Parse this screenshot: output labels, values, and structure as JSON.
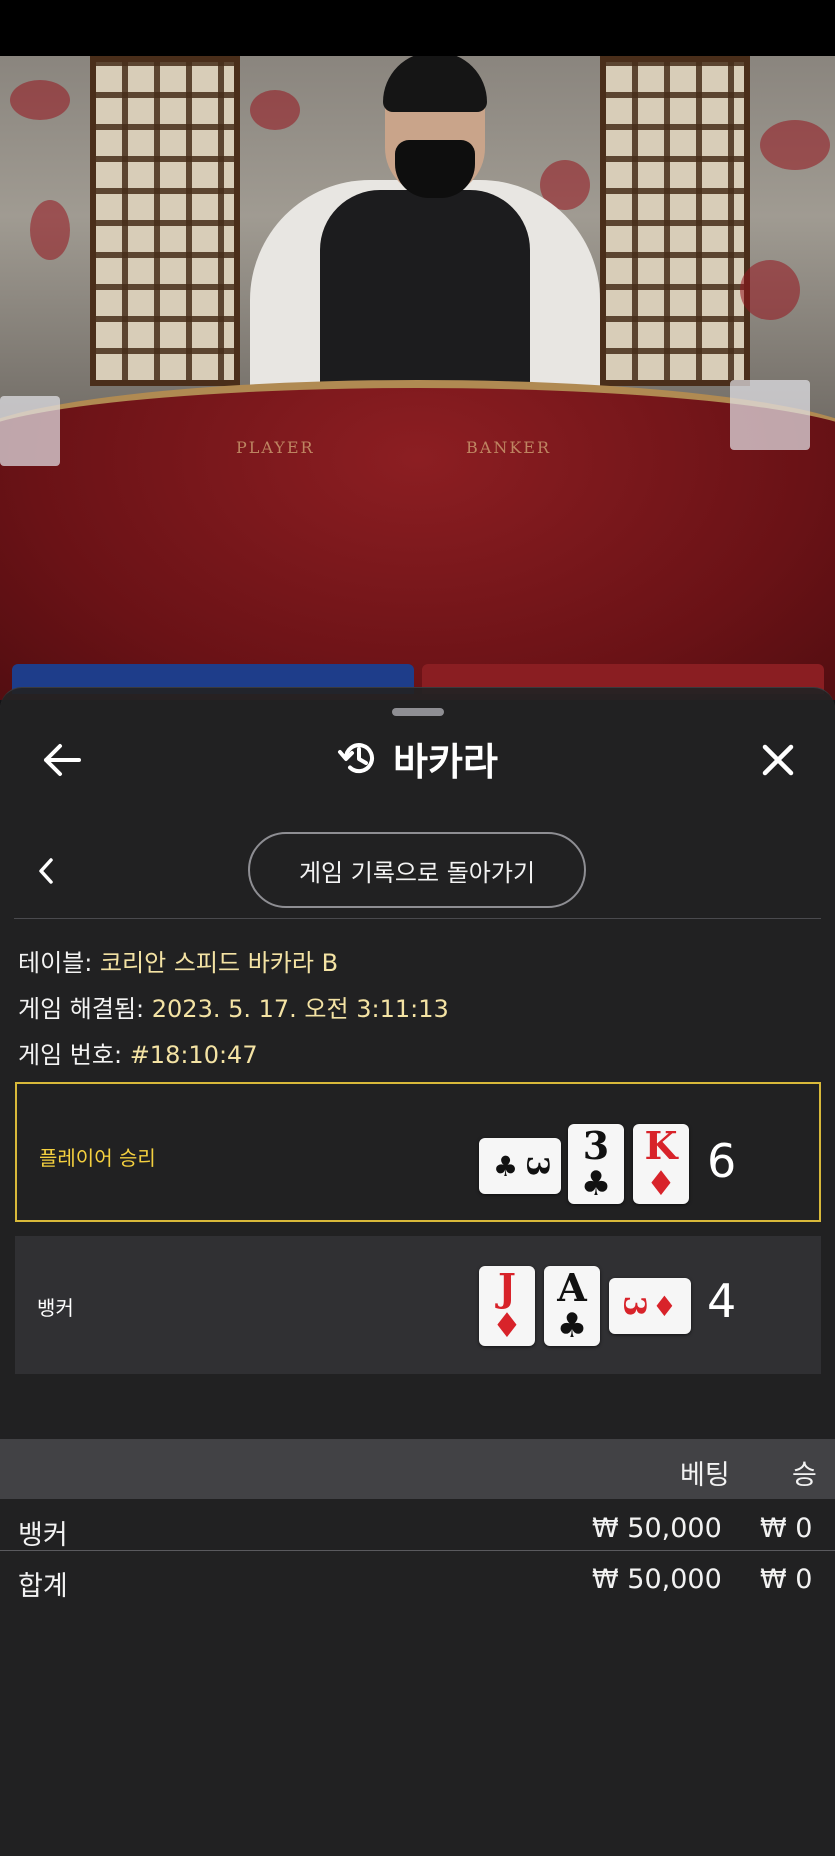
{
  "header": {
    "title": "바카라",
    "back_icon": "arrow-left-icon",
    "history_icon": "history-icon",
    "close_icon": "close-icon"
  },
  "nav": {
    "prev_icon": "chevron-left-icon",
    "back_to_history_label": "게임 기록으로 돌아가기"
  },
  "info": {
    "table_label": "테이블:",
    "table_value": "코리안 스피드 바카라 B",
    "resolved_label": "게임 해결됨:",
    "resolved_value": "2023. 5. 17. 오전 3:11:13",
    "game_no_label": "게임 번호:",
    "game_no_value": "#18:10:47"
  },
  "player": {
    "label": "플레이어 승리",
    "label_color": "#f4d03f",
    "score": "6",
    "cards": [
      {
        "rank": "3",
        "suit": "♣",
        "color": "black",
        "orientation": "horizontal"
      },
      {
        "rank": "3",
        "suit": "♣",
        "color": "black",
        "orientation": "vertical"
      },
      {
        "rank": "K",
        "suit": "♦",
        "color": "red",
        "orientation": "vertical"
      }
    ]
  },
  "banker": {
    "label": "뱅커",
    "score": "4",
    "cards": [
      {
        "rank": "J",
        "suit": "♦",
        "color": "red",
        "orientation": "vertical"
      },
      {
        "rank": "A",
        "suit": "♣",
        "color": "black",
        "orientation": "vertical"
      },
      {
        "rank": "3",
        "suit": "♦",
        "color": "red",
        "orientation": "horizontal"
      }
    ]
  },
  "bets": {
    "col_bet": "베팅",
    "col_win": "승",
    "rows": [
      {
        "name": "뱅커",
        "bet": "₩ 50,000",
        "win": "₩ 0"
      }
    ],
    "total": {
      "name": "합계",
      "bet": "₩ 50,000",
      "win": "₩ 0"
    }
  },
  "video": {
    "table_left_label": "PLAYER",
    "table_right_label": "BANKER"
  },
  "colors": {
    "accent_gold": "#d8b93a",
    "sheet_bg": "#222224",
    "card_red": "#d8232a"
  }
}
